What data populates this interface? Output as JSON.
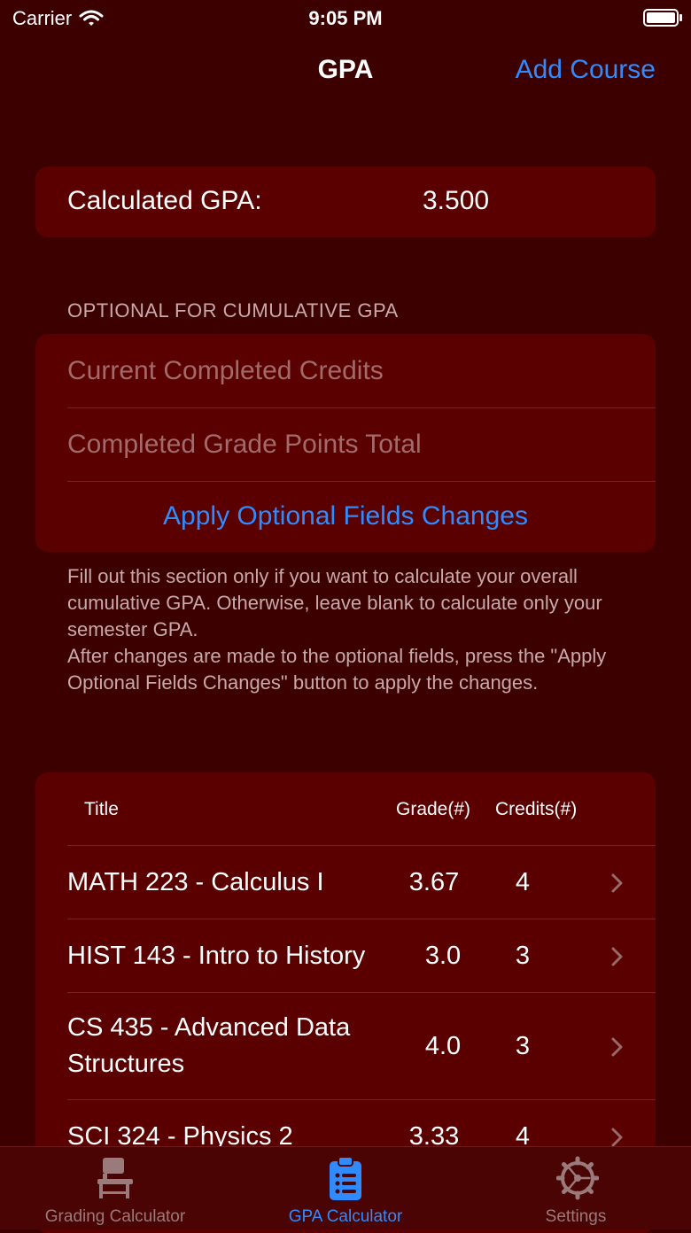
{
  "status_bar": {
    "carrier": "Carrier",
    "time": "9:05 PM"
  },
  "nav": {
    "title": "GPA",
    "add_course_label": "Add Course"
  },
  "gpa": {
    "label": "Calculated GPA:",
    "value": "3.500"
  },
  "optional_section": {
    "header": "OPTIONAL FOR CUMULATIVE GPA",
    "credits_placeholder": "Current Completed Credits",
    "credits_value": "",
    "grade_points_placeholder": "Completed Grade Points Total",
    "grade_points_value": "",
    "apply_label": "Apply Optional Fields Changes",
    "footer_line1": "Fill out this section only if you want to calculate your overall cumulative GPA. Otherwise, leave blank to calculate only your semester GPA.",
    "footer_line2": "After changes are made to the optional fields, press the \"Apply Optional Fields Changes\" button to apply the changes."
  },
  "course_table": {
    "col_title": "Title",
    "col_grade": "Grade(#)",
    "col_credits": "Credits(#)",
    "rows": [
      {
        "title": "MATH 223 - Calculus I",
        "grade": "3.67",
        "credits": "4"
      },
      {
        "title": "HIST 143 - Intro to History",
        "grade": "3.0",
        "credits": "3"
      },
      {
        "title": "CS 435 - Advanced Data Structures",
        "grade": "4.0",
        "credits": "3"
      },
      {
        "title": "SCI 324 - Physics 2",
        "grade": "3.33",
        "credits": "4"
      }
    ]
  },
  "tab_bar": {
    "items": [
      {
        "label": "Grading Calculator",
        "icon": "desk-chair-icon",
        "active": false
      },
      {
        "label": "GPA Calculator",
        "icon": "clipboard-list-icon",
        "active": true
      },
      {
        "label": "Settings",
        "icon": "gear-icon",
        "active": false
      }
    ]
  },
  "colors": {
    "background": "#3d0000",
    "card": "#5a0000",
    "accent": "#2f8bff",
    "secondary_text": "#c7a9a9",
    "placeholder": "#a36a6a",
    "tab_inactive": "#9a7a7a"
  }
}
